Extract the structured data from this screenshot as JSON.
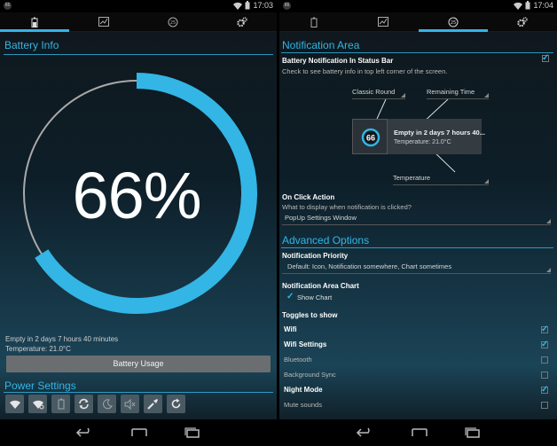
{
  "left": {
    "status_time": "17:03",
    "tabs": [
      {
        "icon": "battery-icon",
        "active": true
      },
      {
        "icon": "chart-icon",
        "active": false
      },
      {
        "icon": "temperature-icon",
        "active": false
      },
      {
        "icon": "gear-icon",
        "active": false
      }
    ],
    "battery_info_title": "Battery Info",
    "battery_level": 66,
    "percent_text": "66%",
    "empty_in": "Empty in 2 days 7 hours 40 minutes",
    "temperature": "Temperature: 21.0°C",
    "battery_usage_button": "Battery Usage",
    "power_settings_title": "Power Settings",
    "power_icons": [
      "wifi-icon",
      "wifi-settings-icon",
      "battery-saver-icon",
      "sync-icon",
      "night-mode-icon",
      "mute-icon",
      "flashlight-icon",
      "refresh-icon"
    ],
    "accent_color": "#33b5e5"
  },
  "right": {
    "status_time": "17:04",
    "tabs": [
      {
        "icon": "battery-icon",
        "active": false
      },
      {
        "icon": "chart-icon",
        "active": false
      },
      {
        "icon": "temperature-icon",
        "active": true
      },
      {
        "icon": "gear-icon",
        "active": false
      }
    ],
    "notification_area_title": "Notification Area",
    "battery_notification_label": "Battery Notification In Status Bar",
    "battery_notification_desc": "Check to see battery info in top left corner of the screen.",
    "battery_notification_checked": true,
    "spinner_icon_style": "Classic Round",
    "spinner_remaining": "Remaining Time",
    "preview_level": "66",
    "preview_title": "Empty in 2 days 7 hours 40...",
    "preview_temp": "Temperature: 21.0°C",
    "spinner_temperature": "Temperature",
    "on_click_label": "On Click Action",
    "on_click_desc": "What to display when notification is clicked?",
    "on_click_value": "PopUp Settings Window",
    "advanced_title": "Advanced Options",
    "priority_label": "Notification Priority",
    "priority_value": "Default: Icon, Notification somewhere, Chart sometimes",
    "area_chart_label": "Notification Area Chart",
    "show_chart_label": "Show Chart",
    "show_chart_checked": true,
    "toggles_label": "Toggles to show",
    "toggles": [
      {
        "label": "Wifi",
        "checked": true
      },
      {
        "label": "Wifi Settings",
        "checked": true
      },
      {
        "label": "Bluetooth",
        "checked": false
      },
      {
        "label": "Background Sync",
        "checked": false
      },
      {
        "label": "Night Mode",
        "checked": true
      },
      {
        "label": "Mute sounds",
        "checked": false
      }
    ]
  }
}
